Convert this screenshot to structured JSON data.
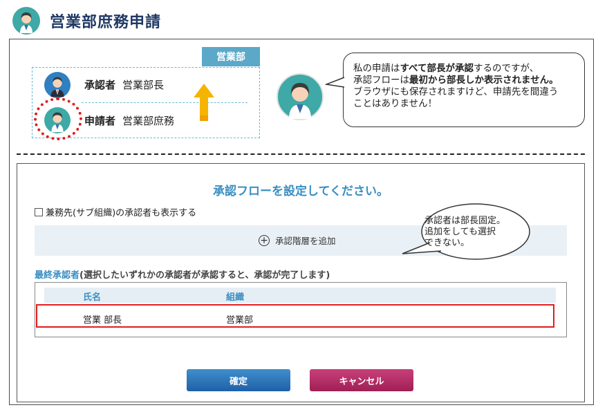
{
  "header": {
    "title": "営業部庶務申請"
  },
  "org": {
    "dept_tab": "営業部",
    "approver": {
      "role": "承認者",
      "name": "営業部長"
    },
    "applicant": {
      "role": "申請者",
      "name": "営業部庶務"
    }
  },
  "callout_top": {
    "l1_pre": "私の申請は",
    "l1_bold": "すべて部長が承認",
    "l1_post": "するのですが、",
    "l2_pre": "承認フローは",
    "l2_bold": "最初から部長しか表示されません。",
    "l3": "ブラウザにも保存されますけど、申請先を間違う",
    "l4": "ことはありません！"
  },
  "dialog": {
    "title": "承認フローを設定してください。",
    "checkbox_label": "兼務先(サブ組織)の承認者も表示する",
    "add_step_label": "承認階層を追加",
    "final_label_accent": "最終承認者",
    "final_label_rest": "(選択したいずれかの承認者が承認すると、承認が完了します)",
    "table": {
      "headers": [
        "氏名",
        "組織"
      ],
      "rows": [
        {
          "name": "営業 部長",
          "org": "営業部"
        }
      ]
    },
    "confirm_label": "確定",
    "cancel_label": "キャンセル"
  },
  "callout_right": {
    "l1": "承認者は部長固定。",
    "l2": "追加をしても選択",
    "l3": "できない。"
  },
  "colors": {
    "accent": "#3a8ec2",
    "highlight": "#e11c1c",
    "dept_tab": "#5ba8c8",
    "confirm": "#2a70b8",
    "cancel": "#b02a62"
  }
}
